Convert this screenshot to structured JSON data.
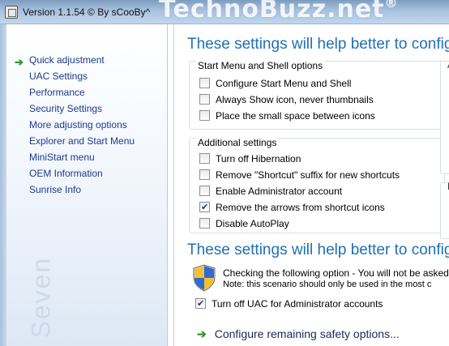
{
  "window": {
    "title": "Version 1.1.54 © By sCooBy^",
    "watermark": "TechnoBuzz.net",
    "watermark_sup": "®"
  },
  "sidebar": {
    "items": [
      {
        "label": "Quick adjustment",
        "active": true
      },
      {
        "label": "UAC Settings"
      },
      {
        "label": "Performance"
      },
      {
        "label": "Security Settings"
      },
      {
        "label": "More adjusting options"
      },
      {
        "label": "Explorer and Start Menu"
      },
      {
        "label": "MiniStart menu"
      },
      {
        "label": "OEM Information"
      },
      {
        "label": "Sunrise Info"
      }
    ],
    "watermark_text": "Seven"
  },
  "main": {
    "heading1": "These settings will help better to config",
    "group1": {
      "title": "Start Menu and Shell options",
      "options": [
        {
          "label": "Configure Start Menu and Shell",
          "checked": false
        },
        {
          "label": "Always Show icon, never thumbnails",
          "checked": false
        },
        {
          "label": "Place the small space between icons",
          "checked": false
        }
      ]
    },
    "group2": {
      "title": "Additional settings",
      "options": [
        {
          "label": "Turn off Hibernation",
          "checked": false
        },
        {
          "label": "Remove \"Shortcut\" suffix for new shortcuts",
          "checked": false
        },
        {
          "label": "Enable Administrator account",
          "checked": false
        },
        {
          "label": "Remove the arrows from shortcut icons",
          "checked": true
        },
        {
          "label": "Disable AutoPlay",
          "checked": false
        }
      ]
    },
    "right_group1_letter": "A",
    "right_group2_letter": "M",
    "heading2": "These settings will help better to config",
    "uac": {
      "line1": "Checking the following option - You will not be asked",
      "line2": "Note: this scenario should only be used in the most c",
      "checkbox_label": "Turn off UAC for Administrator accounts",
      "checked": true
    },
    "remaining_link": "Configure remaining safety options..."
  }
}
